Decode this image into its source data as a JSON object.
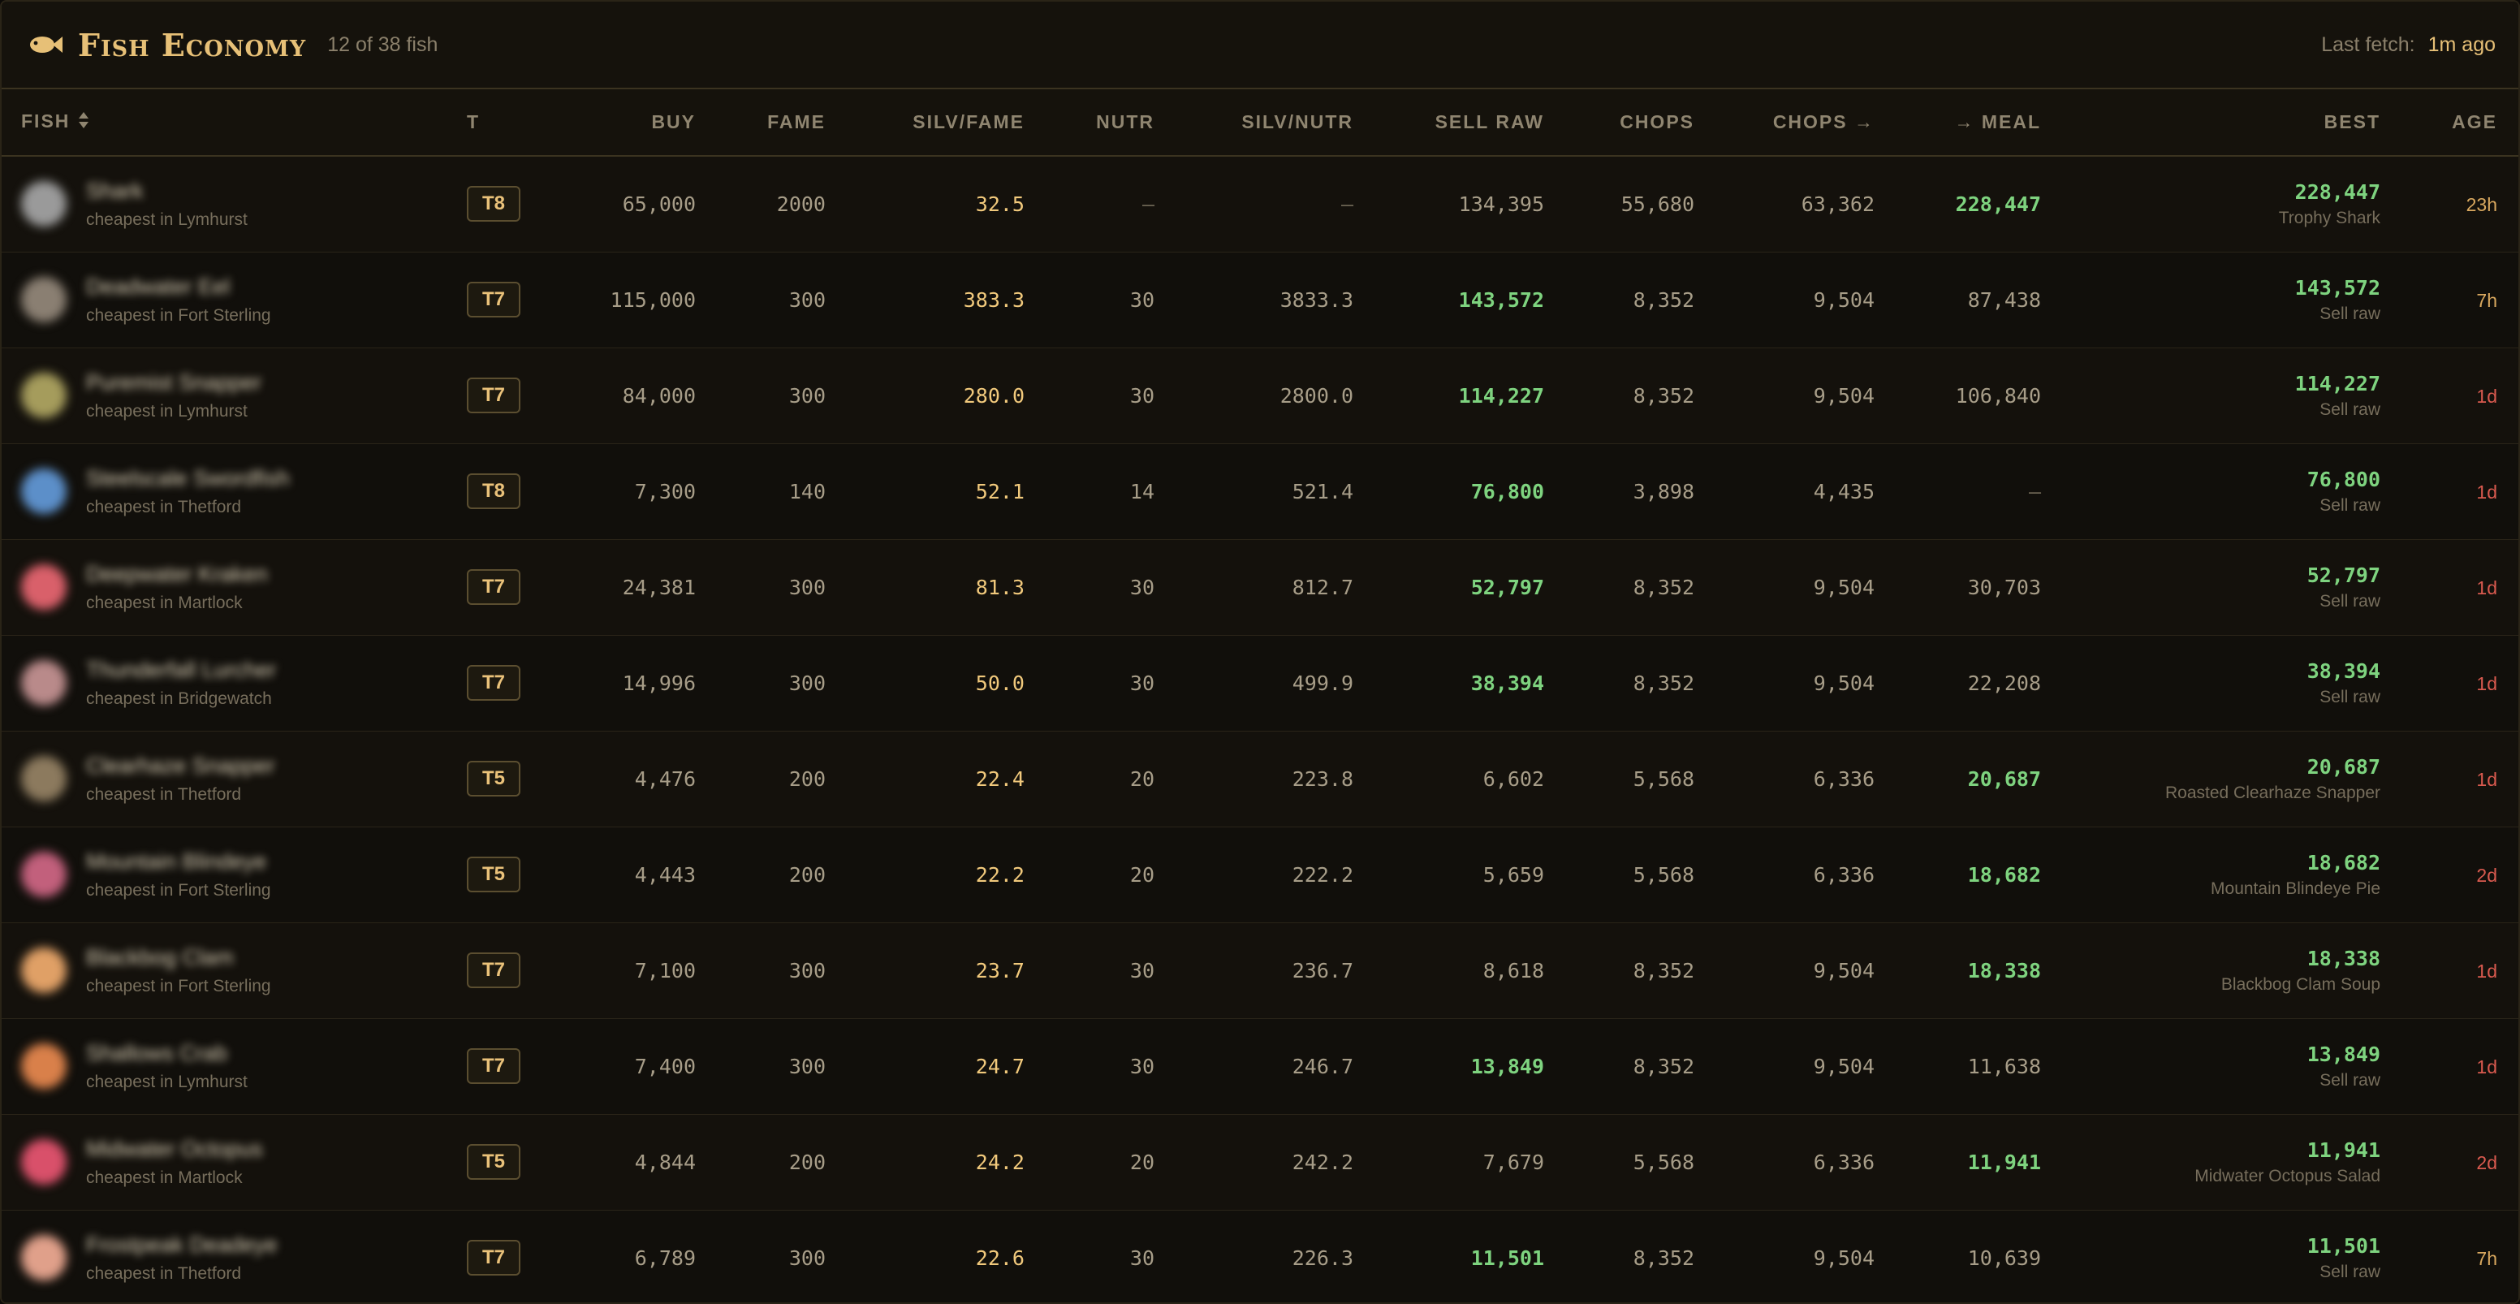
{
  "header": {
    "title": "Fish Economy",
    "count": "12 of 38 fish",
    "fetch_label": "Last fetch:",
    "fetch_value": "1m ago"
  },
  "columns": [
    "FISH",
    "T",
    "BUY",
    "FAME",
    "SILV/FAME",
    "NUTR",
    "SILV/NUTR",
    "SELL RAW",
    "CHOPS",
    "CHOPS →",
    "→ MEAL",
    "BEST",
    "AGE"
  ],
  "colors": {
    "accent": "#e7c077",
    "green": "#7ed37f",
    "red": "#d95a4f",
    "orange": "#d9a85f"
  },
  "rows": [
    {
      "name": "Shark",
      "sub": "cheapest in Lymhurst",
      "color": "#9a9a9a",
      "tier": "T8",
      "buy": "65,000",
      "fame": "2000",
      "silv_fame": "32.5",
      "nutr": "—",
      "silv_nutr": "—",
      "sell_raw": "134,395",
      "chops": "55,680",
      "chops_to": "63,362",
      "meal": "228,447",
      "best_val": "228,447",
      "best_sub": "Trophy Shark",
      "age": "23h",
      "hl": "meal",
      "age_level": "mid"
    },
    {
      "name": "Deadwater Eel",
      "sub": "cheapest in Fort Sterling",
      "color": "#8a7f72",
      "tier": "T7",
      "buy": "115,000",
      "fame": "300",
      "silv_fame": "383.3",
      "nutr": "30",
      "silv_nutr": "3833.3",
      "sell_raw": "143,572",
      "chops": "8,352",
      "chops_to": "9,504",
      "meal": "87,438",
      "best_val": "143,572",
      "best_sub": "Sell raw",
      "age": "7h",
      "hl": "sell",
      "age_level": "mid"
    },
    {
      "name": "Puremist Snapper",
      "sub": "cheapest in Lymhurst",
      "color": "#a59c5c",
      "tier": "T7",
      "buy": "84,000",
      "fame": "300",
      "silv_fame": "280.0",
      "nutr": "30",
      "silv_nutr": "2800.0",
      "sell_raw": "114,227",
      "chops": "8,352",
      "chops_to": "9,504",
      "meal": "106,840",
      "best_val": "114,227",
      "best_sub": "Sell raw",
      "age": "1d",
      "hl": "sell",
      "age_level": "old"
    },
    {
      "name": "Steelscale Swordfish",
      "sub": "cheapest in Thetford",
      "color": "#5c8fc9",
      "tier": "T8",
      "buy": "7,300",
      "fame": "140",
      "silv_fame": "52.1",
      "nutr": "14",
      "silv_nutr": "521.4",
      "sell_raw": "76,800",
      "chops": "3,898",
      "chops_to": "4,435",
      "meal": "—",
      "best_val": "76,800",
      "best_sub": "Sell raw",
      "age": "1d",
      "hl": "sell",
      "age_level": "old"
    },
    {
      "name": "Deepwater Kraken",
      "sub": "cheapest in Martlock",
      "color": "#d9606a",
      "tier": "T7",
      "buy": "24,381",
      "fame": "300",
      "silv_fame": "81.3",
      "nutr": "30",
      "silv_nutr": "812.7",
      "sell_raw": "52,797",
      "chops": "8,352",
      "chops_to": "9,504",
      "meal": "30,703",
      "best_val": "52,797",
      "best_sub": "Sell raw",
      "age": "1d",
      "hl": "sell",
      "age_level": "old"
    },
    {
      "name": "Thunderfall Lurcher",
      "sub": "cheapest in Bridgewatch",
      "color": "#b98a8a",
      "tier": "T7",
      "buy": "14,996",
      "fame": "300",
      "silv_fame": "50.0",
      "nutr": "30",
      "silv_nutr": "499.9",
      "sell_raw": "38,394",
      "chops": "8,352",
      "chops_to": "9,504",
      "meal": "22,208",
      "best_val": "38,394",
      "best_sub": "Sell raw",
      "age": "1d",
      "hl": "sell",
      "age_level": "old"
    },
    {
      "name": "Clearhaze Snapper",
      "sub": "cheapest in Thetford",
      "color": "#8c7a5e",
      "tier": "T5",
      "buy": "4,476",
      "fame": "200",
      "silv_fame": "22.4",
      "nutr": "20",
      "silv_nutr": "223.8",
      "sell_raw": "6,602",
      "chops": "5,568",
      "chops_to": "6,336",
      "meal": "20,687",
      "best_val": "20,687",
      "best_sub": "Roasted Clearhaze Snapper",
      "age": "1d",
      "hl": "meal",
      "age_level": "old"
    },
    {
      "name": "Mountain Blindeye",
      "sub": "cheapest in Fort Sterling",
      "color": "#c2607c",
      "tier": "T5",
      "buy": "4,443",
      "fame": "200",
      "silv_fame": "22.2",
      "nutr": "20",
      "silv_nutr": "222.2",
      "sell_raw": "5,659",
      "chops": "5,568",
      "chops_to": "6,336",
      "meal": "18,682",
      "best_val": "18,682",
      "best_sub": "Mountain Blindeye Pie",
      "age": "2d",
      "hl": "meal",
      "age_level": "old"
    },
    {
      "name": "Blackbog Clam",
      "sub": "cheapest in Fort Sterling",
      "color": "#e0a066",
      "tier": "T7",
      "buy": "7,100",
      "fame": "300",
      "silv_fame": "23.7",
      "nutr": "30",
      "silv_nutr": "236.7",
      "sell_raw": "8,618",
      "chops": "8,352",
      "chops_to": "9,504",
      "meal": "18,338",
      "best_val": "18,338",
      "best_sub": "Blackbog Clam Soup",
      "age": "1d",
      "hl": "meal",
      "age_level": "old"
    },
    {
      "name": "Shallows Crab",
      "sub": "cheapest in Lymhurst",
      "color": "#d9804a",
      "tier": "T7",
      "buy": "7,400",
      "fame": "300",
      "silv_fame": "24.7",
      "nutr": "30",
      "silv_nutr": "246.7",
      "sell_raw": "13,849",
      "chops": "8,352",
      "chops_to": "9,504",
      "meal": "11,638",
      "best_val": "13,849",
      "best_sub": "Sell raw",
      "age": "1d",
      "hl": "sell",
      "age_level": "old"
    },
    {
      "name": "Midwater Octopus",
      "sub": "cheapest in Martlock",
      "color": "#d9506a",
      "tier": "T5",
      "buy": "4,844",
      "fame": "200",
      "silv_fame": "24.2",
      "nutr": "20",
      "silv_nutr": "242.2",
      "sell_raw": "7,679",
      "chops": "5,568",
      "chops_to": "6,336",
      "meal": "11,941",
      "best_val": "11,941",
      "best_sub": "Midwater Octopus Salad",
      "age": "2d",
      "hl": "meal",
      "age_level": "old"
    },
    {
      "name": "Frostpeak Deadeye",
      "sub": "cheapest in Thetford",
      "color": "#e0a08a",
      "tier": "T7",
      "buy": "6,789",
      "fame": "300",
      "silv_fame": "22.6",
      "nutr": "30",
      "silv_nutr": "226.3",
      "sell_raw": "11,501",
      "chops": "8,352",
      "chops_to": "9,504",
      "meal": "10,639",
      "best_val": "11,501",
      "best_sub": "Sell raw",
      "age": "7h",
      "hl": "sell",
      "age_level": "mid"
    }
  ]
}
